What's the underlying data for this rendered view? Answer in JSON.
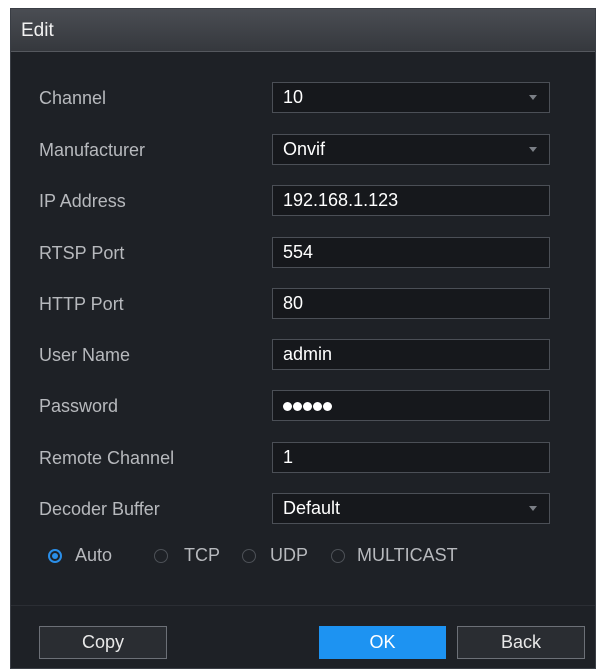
{
  "dialog": {
    "title": "Edit"
  },
  "fields": {
    "channel": {
      "label": "Channel",
      "value": "10"
    },
    "manufacturer": {
      "label": "Manufacturer",
      "value": "Onvif"
    },
    "ip_address": {
      "label": "IP Address",
      "value": "192.168.1.123"
    },
    "rtsp_port": {
      "label": "RTSP Port",
      "value": "554"
    },
    "http_port": {
      "label": "HTTP Port",
      "value": "80"
    },
    "user_name": {
      "label": "User Name",
      "value": "admin"
    },
    "password": {
      "label": "Password",
      "masked_length": 5
    },
    "remote_channel": {
      "label": "Remote Channel",
      "value": "1"
    },
    "decoder_buffer": {
      "label": "Decoder Buffer",
      "value": "Default"
    }
  },
  "protocol": {
    "options": [
      "Auto",
      "TCP",
      "UDP",
      "MULTICAST"
    ],
    "selected": "Auto"
  },
  "buttons": {
    "copy": "Copy",
    "ok": "OK",
    "back": "Back"
  },
  "colors": {
    "accent": "#1d93f2",
    "dialog_bg": "#1e2126",
    "field_bg": "#16181c",
    "label_text": "#b7b9bd"
  },
  "icons": {
    "dropdown": "chevron-down-icon",
    "radio": "radio-icon"
  }
}
